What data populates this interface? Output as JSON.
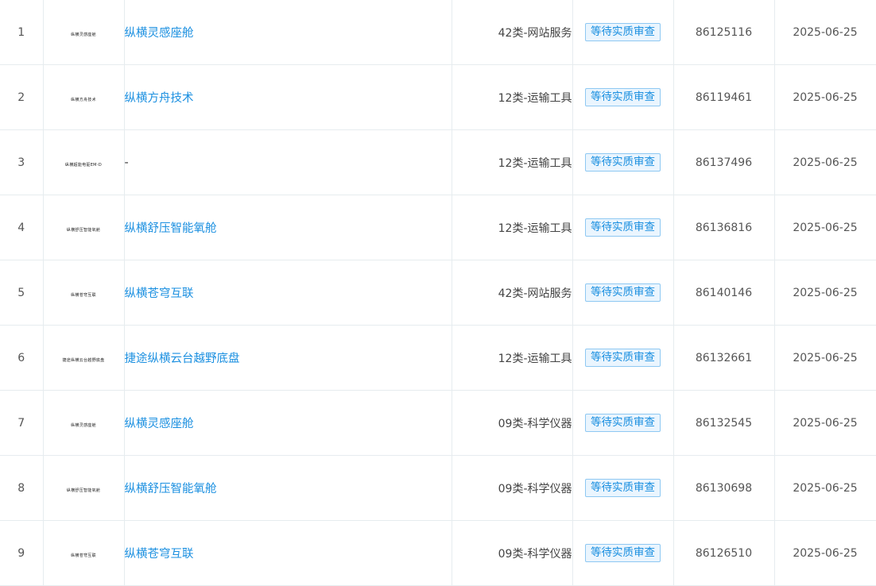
{
  "rows": [
    {
      "index": "1",
      "logo_text": "纵横灵感座舱",
      "name": "纵横灵感座舱",
      "class": "42类-网站服务",
      "status": "等待实质审查",
      "reg_no": "86125116",
      "date": "2025-06-25"
    },
    {
      "index": "2",
      "logo_text": "纵横方舟技术",
      "name": "纵横方舟技术",
      "class": "12类-运输工具",
      "status": "等待实质审查",
      "reg_no": "86119461",
      "date": "2025-06-25"
    },
    {
      "index": "3",
      "logo_text": "纵横超能电驱EM-D",
      "name": "-",
      "class": "12类-运输工具",
      "status": "等待实质审查",
      "reg_no": "86137496",
      "date": "2025-06-25"
    },
    {
      "index": "4",
      "logo_text": "纵横舒压智能氧舱",
      "name": "纵横舒压智能氧舱",
      "class": "12类-运输工具",
      "status": "等待实质审查",
      "reg_no": "86136816",
      "date": "2025-06-25"
    },
    {
      "index": "5",
      "logo_text": "纵横苍穹互联",
      "name": "纵横苍穹互联",
      "class": "42类-网站服务",
      "status": "等待实质审查",
      "reg_no": "86140146",
      "date": "2025-06-25"
    },
    {
      "index": "6",
      "logo_text": "捷途纵横云台越野底盘",
      "name": "捷途纵横云台越野底盘",
      "class": "12类-运输工具",
      "status": "等待实质审查",
      "reg_no": "86132661",
      "date": "2025-06-25"
    },
    {
      "index": "7",
      "logo_text": "纵横灵感座舱",
      "name": "纵横灵感座舱",
      "class": "09类-科学仪器",
      "status": "等待实质审查",
      "reg_no": "86132545",
      "date": "2025-06-25"
    },
    {
      "index": "8",
      "logo_text": "纵横舒压智能氧舱",
      "name": "纵横舒压智能氧舱",
      "class": "09类-科学仪器",
      "status": "等待实质审查",
      "reg_no": "86130698",
      "date": "2025-06-25"
    },
    {
      "index": "9",
      "logo_text": "纵横苍穹互联",
      "name": "纵横苍穹互联",
      "class": "09类-科学仪器",
      "status": "等待实质审查",
      "reg_no": "86126510",
      "date": "2025-06-25"
    }
  ]
}
